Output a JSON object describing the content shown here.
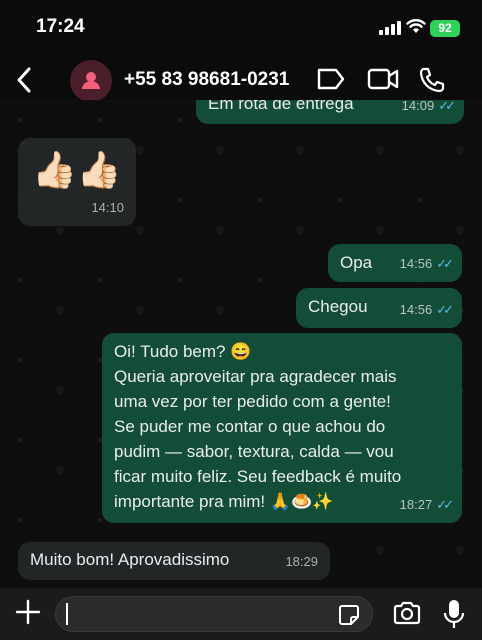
{
  "status_bar": {
    "time": "17:24",
    "battery": "92"
  },
  "header": {
    "contact_name": "+55 83 98681-0231"
  },
  "messages": [
    {
      "direction": "out",
      "text": "Em rota de entrega",
      "time": "14:09"
    },
    {
      "direction": "in",
      "text": "👍🏻👍🏻",
      "time": "14:10"
    },
    {
      "direction": "out",
      "text": "Opa",
      "time": "14:56"
    },
    {
      "direction": "out",
      "text": "Chegou",
      "time": "14:56"
    },
    {
      "direction": "out",
      "lines": [
        "Oi! Tudo bem? 😄",
        "Queria aproveitar pra agradecer mais",
        "uma vez por ter pedido com a gente!",
        "Se puder me contar o que achou do",
        "pudim — sabor, textura, calda — vou",
        "ficar muito feliz. Seu feedback é muito",
        "importante pra mim! 🙏🍮✨"
      ],
      "time": "18:27"
    },
    {
      "direction": "in",
      "text": "Muito bom! Aprovadissimo",
      "time": "18:29"
    }
  ],
  "colors": {
    "outgoing_bubble": "#144d37",
    "incoming_bubble": "#1f2c2c",
    "read_ticks": "#53bdeb",
    "battery": "#30d158"
  }
}
